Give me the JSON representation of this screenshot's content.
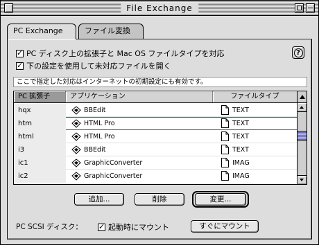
{
  "window": {
    "title": "File Exchange"
  },
  "tabs": [
    {
      "label": "PC Exchange",
      "active": true
    },
    {
      "label": "ファイル変換",
      "active": false
    }
  ],
  "options": {
    "map_extensions": {
      "label": "PC ディスク上の拡張子と Mac OS ファイルタイプを対応",
      "checked": true
    },
    "open_unmapped": {
      "label": "下の設定を使用して未対応ファイルを開く",
      "checked": true
    }
  },
  "help_label": "?",
  "note": "ここで指定した対応はインターネットの初期設定にも有効です。",
  "table": {
    "headers": {
      "extension": "PC 拡張子",
      "application": "アプリケーション",
      "file_type": "ファイルタイプ"
    },
    "rows": [
      {
        "ext": "hqx",
        "app": "BBEdit",
        "type": "TEXT",
        "highlight": false
      },
      {
        "ext": "htm",
        "app": "HTML Pro",
        "type": "TEXT",
        "highlight": true
      },
      {
        "ext": "html",
        "app": "HTML Pro",
        "type": "TEXT",
        "highlight": false
      },
      {
        "ext": "i3",
        "app": "BBEdit",
        "type": "TEXT",
        "highlight": false
      },
      {
        "ext": "ic1",
        "app": "GraphicConverter",
        "type": "IMAG",
        "highlight": false
      },
      {
        "ext": "ic2",
        "app": "GraphicConverter",
        "type": "IMAG",
        "highlight": false
      }
    ]
  },
  "buttons": {
    "add": "追加...",
    "remove": "削除",
    "change": "変更..."
  },
  "scsi": {
    "label": "PC SCSI ディスク：",
    "mount_at_startup": {
      "label": "起動時にマウント",
      "checked": true
    },
    "mount_now": "すぐにマウント"
  },
  "colors": {
    "highlight_outline": "#d62020",
    "scroll_thumb": "#9a9ad8"
  }
}
